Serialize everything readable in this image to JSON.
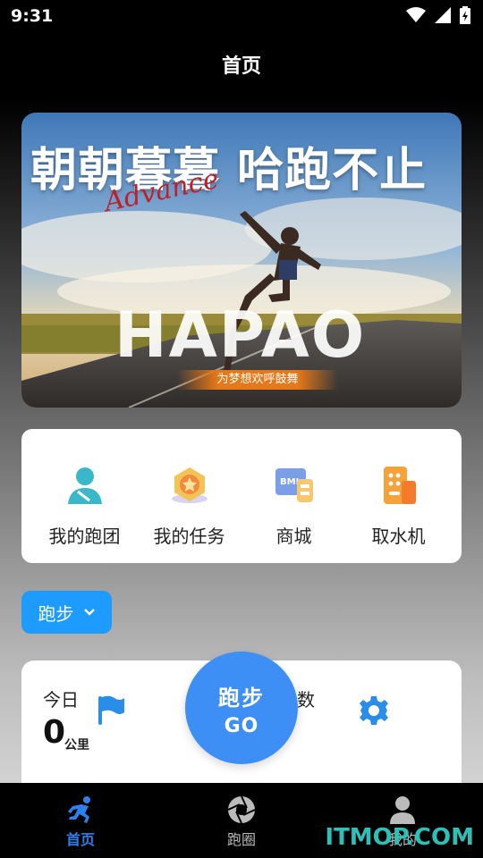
{
  "status_bar": {
    "time": "9:31"
  },
  "header": {
    "title": "首页"
  },
  "banner": {
    "headline": "朝朝暮暮 哈跑不止",
    "script_text": "Advance",
    "brand": "HAPAO",
    "tagline": "为梦想欢呼鼓舞"
  },
  "quick_menu": [
    {
      "label": "我的跑团",
      "icon": "running-group-icon"
    },
    {
      "label": "我的任务",
      "icon": "task-medal-icon"
    },
    {
      "label": "商城",
      "icon": "mall-icon"
    },
    {
      "label": "取水机",
      "icon": "water-dispenser-icon"
    }
  ],
  "sport_selector": {
    "label": "跑步"
  },
  "stats": {
    "today_label": "今日",
    "distance_value": "0",
    "distance_unit": "公里",
    "steps_label_partial": "数"
  },
  "go_button": {
    "line1": "跑步",
    "line2": "GO"
  },
  "bottom_nav": [
    {
      "label": "首页",
      "icon": "runner-icon",
      "active": true
    },
    {
      "label": "跑圈",
      "icon": "aperture-icon",
      "active": false
    },
    {
      "label": "我的",
      "icon": "user-icon",
      "active": false
    }
  ],
  "watermark": "ITMOP.COM",
  "colors": {
    "accent": "#1e9bff",
    "go": "#3d8ef5",
    "nav_active": "#2f80ed"
  }
}
